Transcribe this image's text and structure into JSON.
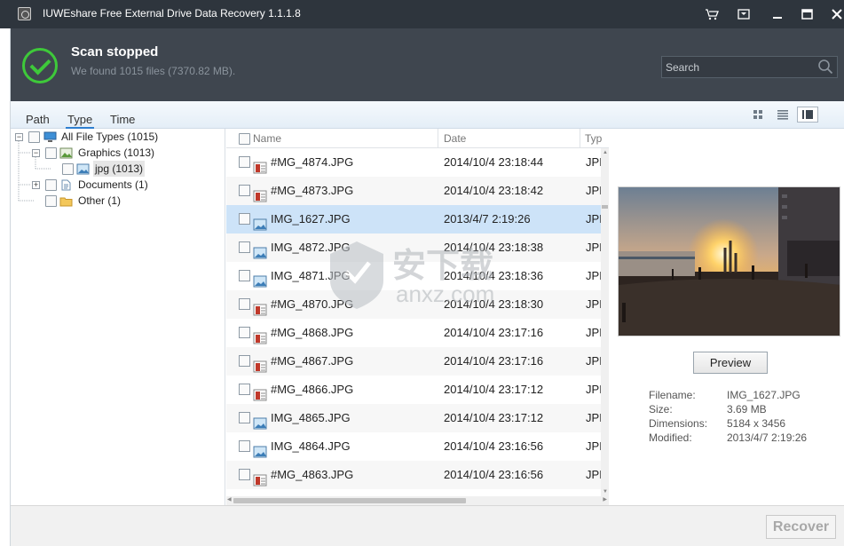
{
  "window": {
    "title": "IUWEshare Free External Drive Data Recovery 1.1.1.8",
    "icons": [
      "cart-icon",
      "menu-icon",
      "minimize-icon",
      "maximize-icon",
      "close-icon"
    ]
  },
  "header": {
    "status_title": "Scan stopped",
    "status_subtitle": "We found 1015 files (7370.82 MB).",
    "search_placeholder": "Search",
    "accent_color": "#3ec93a"
  },
  "tabs": [
    {
      "label": "Path"
    },
    {
      "label": "Type",
      "active": true
    },
    {
      "label": "Time"
    }
  ],
  "tree": [
    {
      "label": "All File Types (1015)",
      "icon": "computer-icon",
      "expander": "−"
    },
    {
      "label": "Graphics (1013)",
      "icon": "image-folder-icon",
      "expander": "−"
    },
    {
      "label": "jpg (1013)",
      "icon": "jpg-icon",
      "selected": true
    },
    {
      "label": "Documents (1)",
      "icon": "document-icon",
      "expander": "+"
    },
    {
      "label": "Other (1)",
      "icon": "folder-icon"
    }
  ],
  "list": {
    "columns": [
      "Name",
      "Date",
      "Typ"
    ],
    "rows": [
      {
        "name": "#MG_4874.JPG",
        "date": "2014/10/4 23:18:44",
        "type": "JPI",
        "damaged": true
      },
      {
        "name": "#MG_4873.JPG",
        "date": "2014/10/4 23:18:42",
        "type": "JPI",
        "damaged": true
      },
      {
        "name": "IMG_1627.JPG",
        "date": "2013/4/7 2:19:26",
        "type": "JPI",
        "damaged": false,
        "selected": true
      },
      {
        "name": "IMG_4872.JPG",
        "date": "2014/10/4 23:18:38",
        "type": "JPI",
        "damaged": false
      },
      {
        "name": "IMG_4871.JPG",
        "date": "2014/10/4 23:18:36",
        "type": "JPI",
        "damaged": false
      },
      {
        "name": "#MG_4870.JPG",
        "date": "2014/10/4 23:18:30",
        "type": "JPI",
        "damaged": true
      },
      {
        "name": "#MG_4868.JPG",
        "date": "2014/10/4 23:17:16",
        "type": "JPI",
        "damaged": true
      },
      {
        "name": "#MG_4867.JPG",
        "date": "2014/10/4 23:17:16",
        "type": "JPI",
        "damaged": true
      },
      {
        "name": "#MG_4866.JPG",
        "date": "2014/10/4 23:17:12",
        "type": "JPI",
        "damaged": true
      },
      {
        "name": "IMG_4865.JPG",
        "date": "2014/10/4 23:17:12",
        "type": "JPI",
        "damaged": false
      },
      {
        "name": "IMG_4864.JPG",
        "date": "2014/10/4 23:16:56",
        "type": "JPI",
        "damaged": false
      },
      {
        "name": "#MG_4863.JPG",
        "date": "2014/10/4 23:16:56",
        "type": "JPI",
        "damaged": true
      }
    ]
  },
  "preview": {
    "button_label": "Preview",
    "meta": [
      {
        "label": "Filename:",
        "value": "IMG_1627.JPG"
      },
      {
        "label": "Size:",
        "value": "3.69 MB"
      },
      {
        "label": "Dimensions:",
        "value": "5184 x 3456"
      },
      {
        "label": "Modified:",
        "value": "2013/4/7 2:19:26"
      }
    ]
  },
  "footer": {
    "recover_label": "Recover"
  },
  "watermark": {
    "text_cn": "安下载",
    "text_en": "anxz.com"
  }
}
